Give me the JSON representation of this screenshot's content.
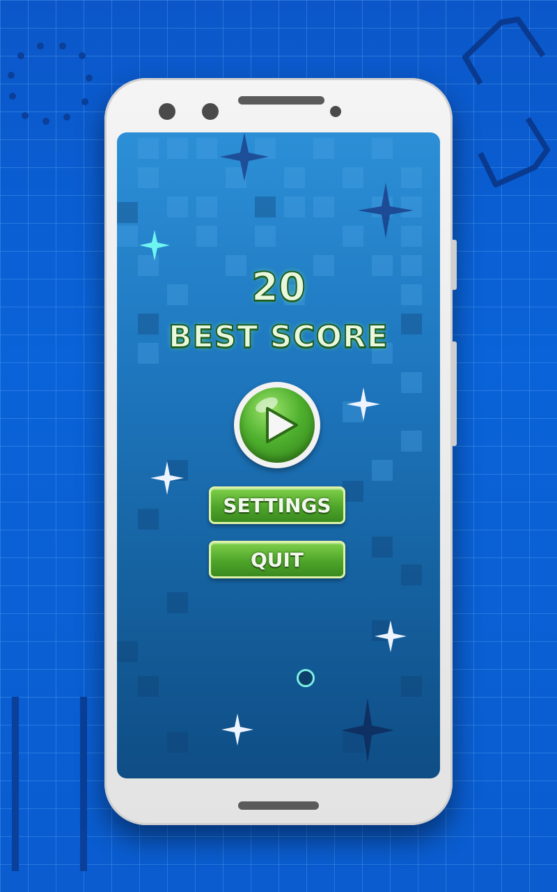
{
  "game": {
    "score": "20",
    "best_score_label": "BEST SCORE",
    "settings_label": "SETTINGS",
    "quit_label": "QUIT",
    "play_icon": "play-icon"
  },
  "colors": {
    "background": "#0a5ccf",
    "screen_top": "#2c8fd6",
    "screen_bottom": "#0f4d85",
    "button_green": "#4ea52a",
    "text_glow": "#e9f7dc"
  }
}
